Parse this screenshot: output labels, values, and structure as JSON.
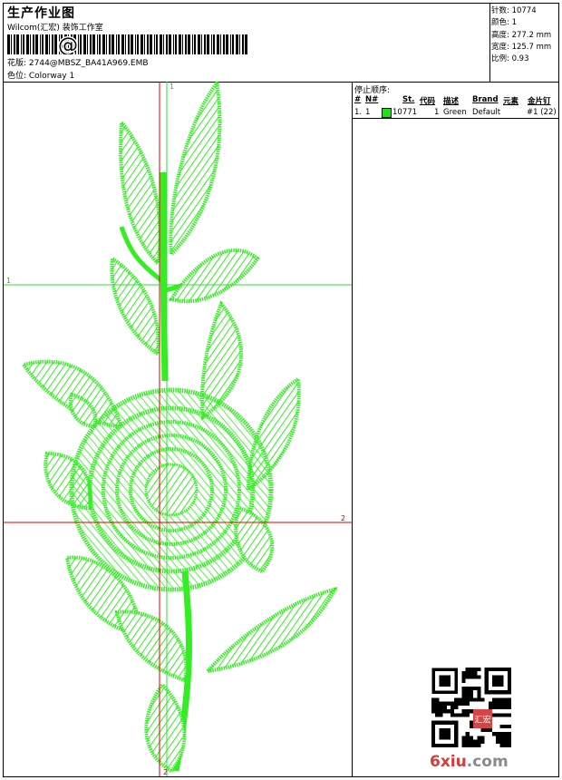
{
  "header": {
    "title": "生产作业图",
    "company": "Wilcom(汇宏) 装饰工作室",
    "design_label": "花版: 2744@MBSZ_BA41A969.EMB",
    "colorway_label": "色位:  Colorway 1"
  },
  "stats": {
    "stitches": "针数: 10774",
    "colors": "颜色: 1",
    "height": "高度: 277.2 mm",
    "width": "宽度: 125.7 mm",
    "scale": "比例: 0.93"
  },
  "canvas": {
    "marker_top": "1",
    "marker_left": "1",
    "marker_right": "2",
    "marker_bottom": "2",
    "thread_color": "#33ee22",
    "guide_red": "#e00000",
    "guide_green": "#33dd33"
  },
  "stop_sequence": {
    "title": "停止顺序:",
    "headers": [
      "#",
      "N#",
      "St.",
      "代码",
      "描述",
      "Brand",
      "元素",
      "金片钉"
    ],
    "rows": [
      {
        "index": "1.",
        "needle": "1",
        "swatch_color": "#22dd22",
        "stitches": "10771",
        "code": "1",
        "description": "Green",
        "brand": "Default",
        "elements": "",
        "sequin": "#1 (22)"
      }
    ]
  },
  "watermark": {
    "digits": "6",
    "rest": "xiu",
    "domain": ".com",
    "stamp_text": "汇宏"
  }
}
